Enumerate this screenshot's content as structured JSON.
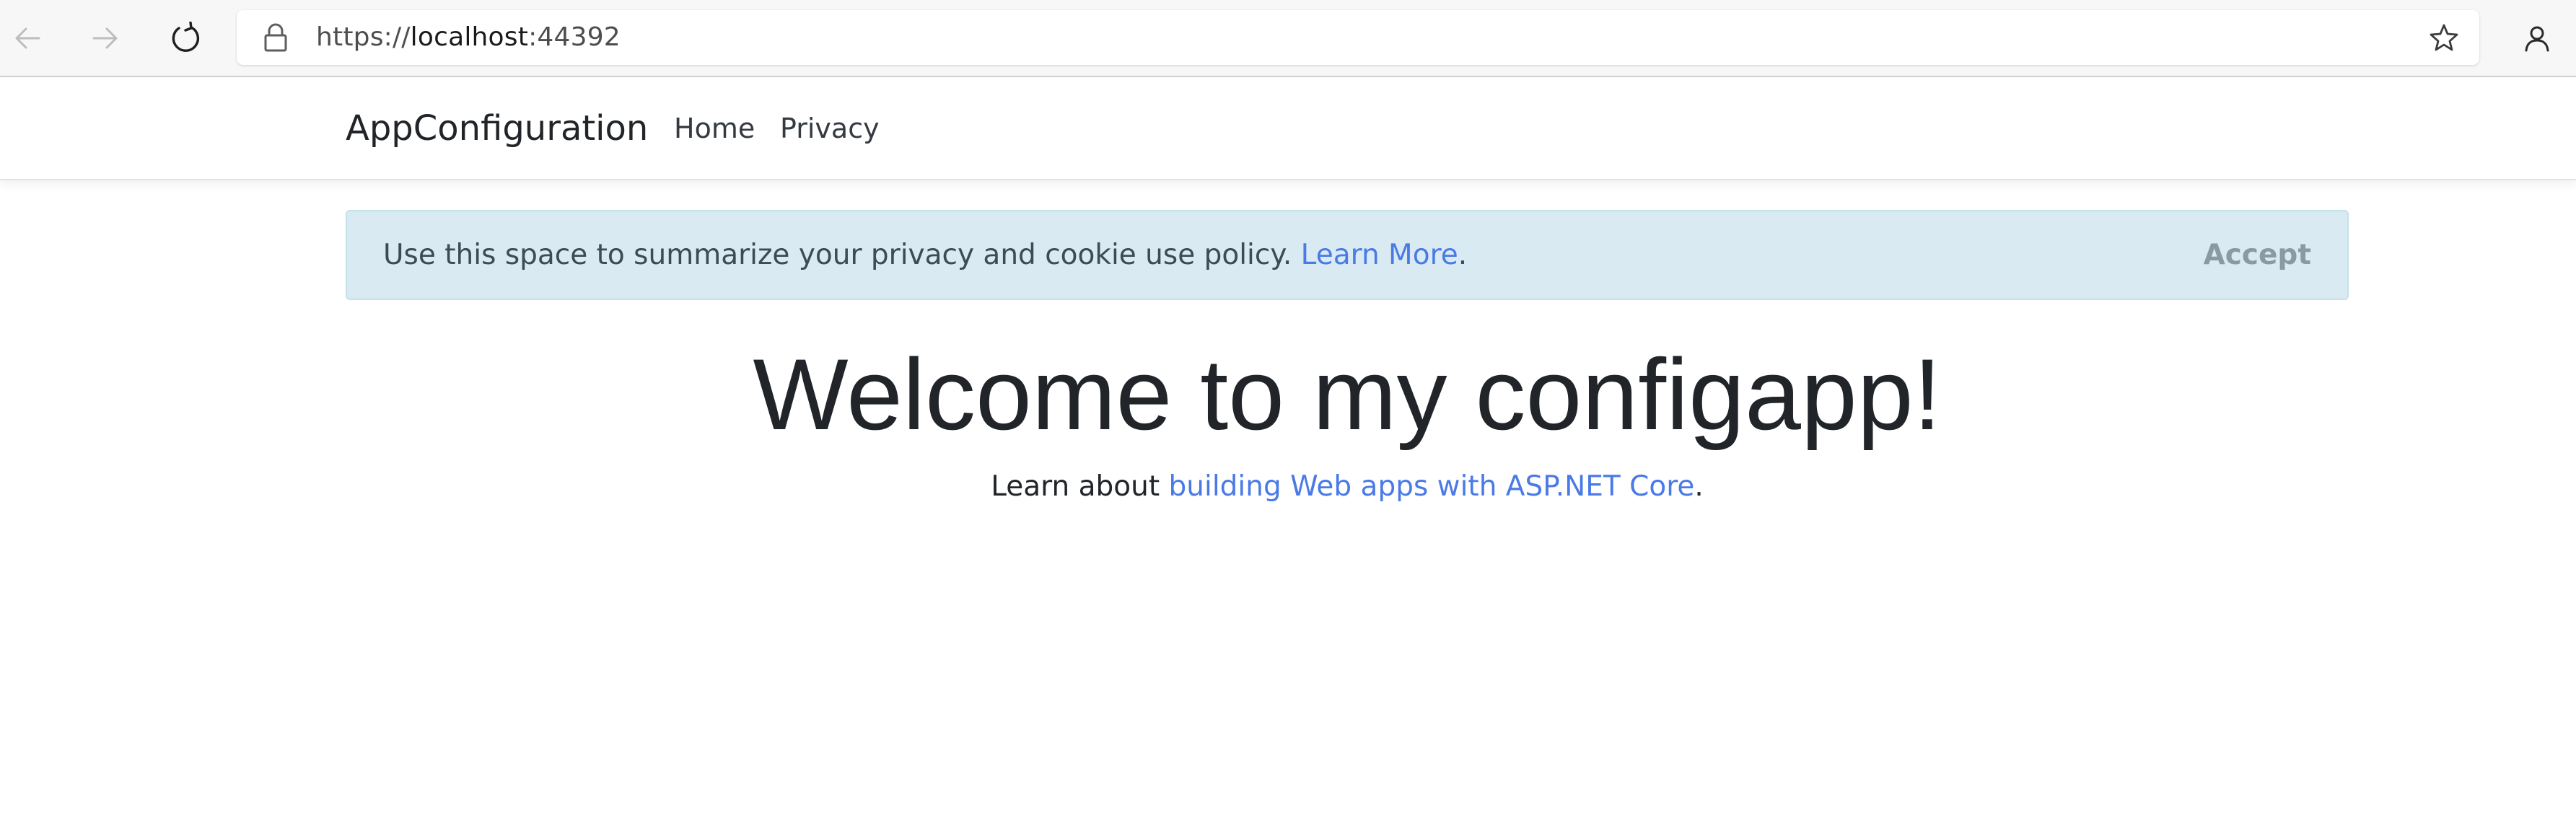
{
  "browser": {
    "url_scheme": "https://",
    "url_host": "localhost",
    "url_port": ":44392"
  },
  "navbar": {
    "brand": "AppConfiguration",
    "links": [
      {
        "label": "Home"
      },
      {
        "label": "Privacy"
      }
    ]
  },
  "cookie_consent": {
    "message": "Use this space to summarize your privacy and cookie use policy. ",
    "link_text": "Learn More",
    "link_suffix": ".",
    "accept_label": "Accept"
  },
  "main": {
    "heading": "Welcome to my configapp!",
    "intro_prefix": "Learn about ",
    "intro_link": "building Web apps with ASP.NET Core",
    "intro_suffix": "."
  },
  "icons": {
    "back": "arrow-left-icon",
    "forward": "arrow-right-icon",
    "reload": "reload-icon",
    "lock": "lock-icon",
    "favorite": "star-icon",
    "profile": "person-icon"
  },
  "colors": {
    "link": "#4a7ae6",
    "alert_bg": "#d9eaf2",
    "accept_text": "#8a9aa3"
  }
}
